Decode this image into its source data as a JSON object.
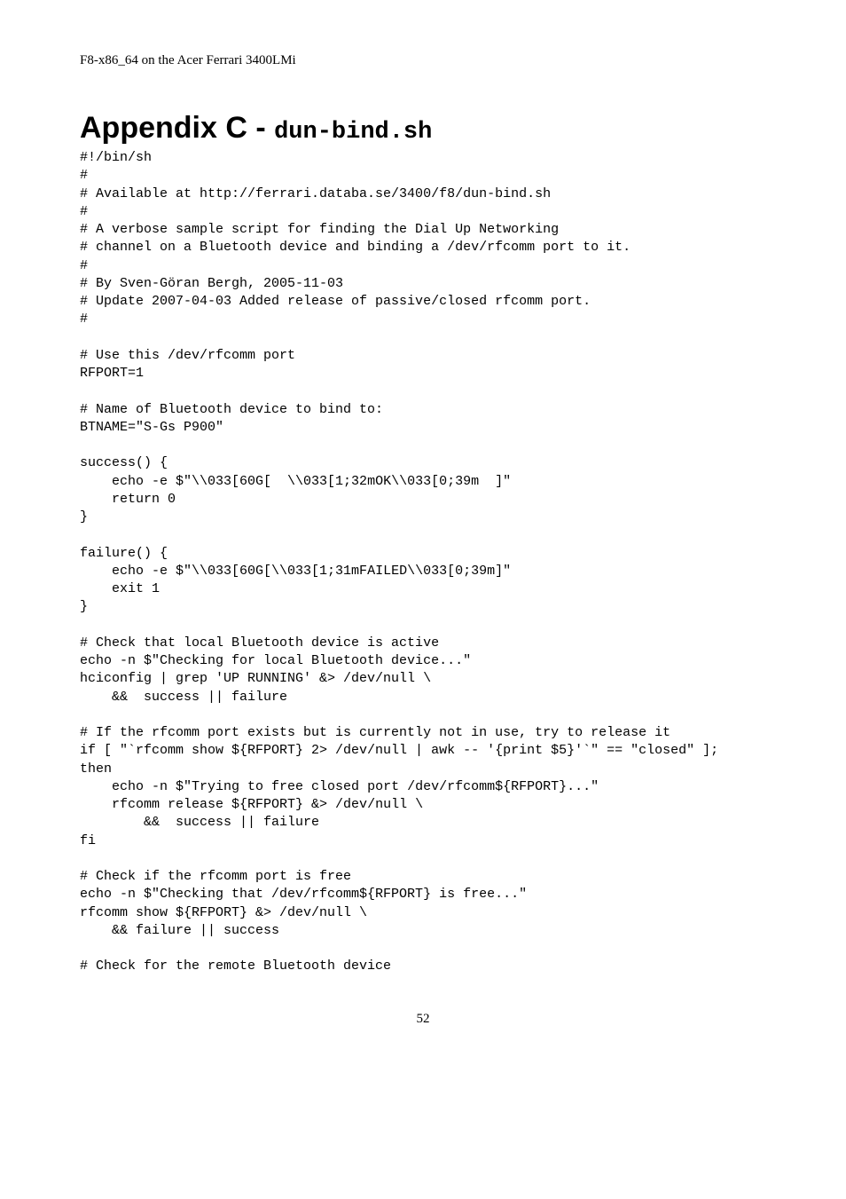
{
  "header": "F8-x86_64 on the Acer Ferrari 3400LMi",
  "title_main": "Appendix C - ",
  "title_code": "dun-bind.sh",
  "code": "#!/bin/sh\n#\n# Available at http://ferrari.databa.se/3400/f8/dun-bind.sh\n#\n# A verbose sample script for finding the Dial Up Networking\n# channel on a Bluetooth device and binding a /dev/rfcomm port to it.\n#\n# By Sven-Göran Bergh, 2005-11-03\n# Update 2007-04-03 Added release of passive/closed rfcomm port.\n#\n\n# Use this /dev/rfcomm port\nRFPORT=1\n\n# Name of Bluetooth device to bind to:\nBTNAME=\"S-Gs P900\"\n\nsuccess() {\n    echo -e $\"\\\\033[60G[  \\\\033[1;32mOK\\\\033[0;39m  ]\"\n    return 0\n}\n\nfailure() {\n    echo -e $\"\\\\033[60G[\\\\033[1;31mFAILED\\\\033[0;39m]\"\n    exit 1\n}\n\n# Check that local Bluetooth device is active\necho -n $\"Checking for local Bluetooth device...\"\nhciconfig | grep 'UP RUNNING' &> /dev/null \\\n    &&  success || failure\n\n# If the rfcomm port exists but is currently not in use, try to release it\nif [ \"`rfcomm show ${RFPORT} 2> /dev/null | awk -- '{print $5}'`\" == \"closed\" ];\nthen\n    echo -n $\"Trying to free closed port /dev/rfcomm${RFPORT}...\"\n    rfcomm release ${RFPORT} &> /dev/null \\\n        &&  success || failure\nfi\n\n# Check if the rfcomm port is free\necho -n $\"Checking that /dev/rfcomm${RFPORT} is free...\"\nrfcomm show ${RFPORT} &> /dev/null \\\n    && failure || success\n\n# Check for the remote Bluetooth device",
  "page_number": "52"
}
